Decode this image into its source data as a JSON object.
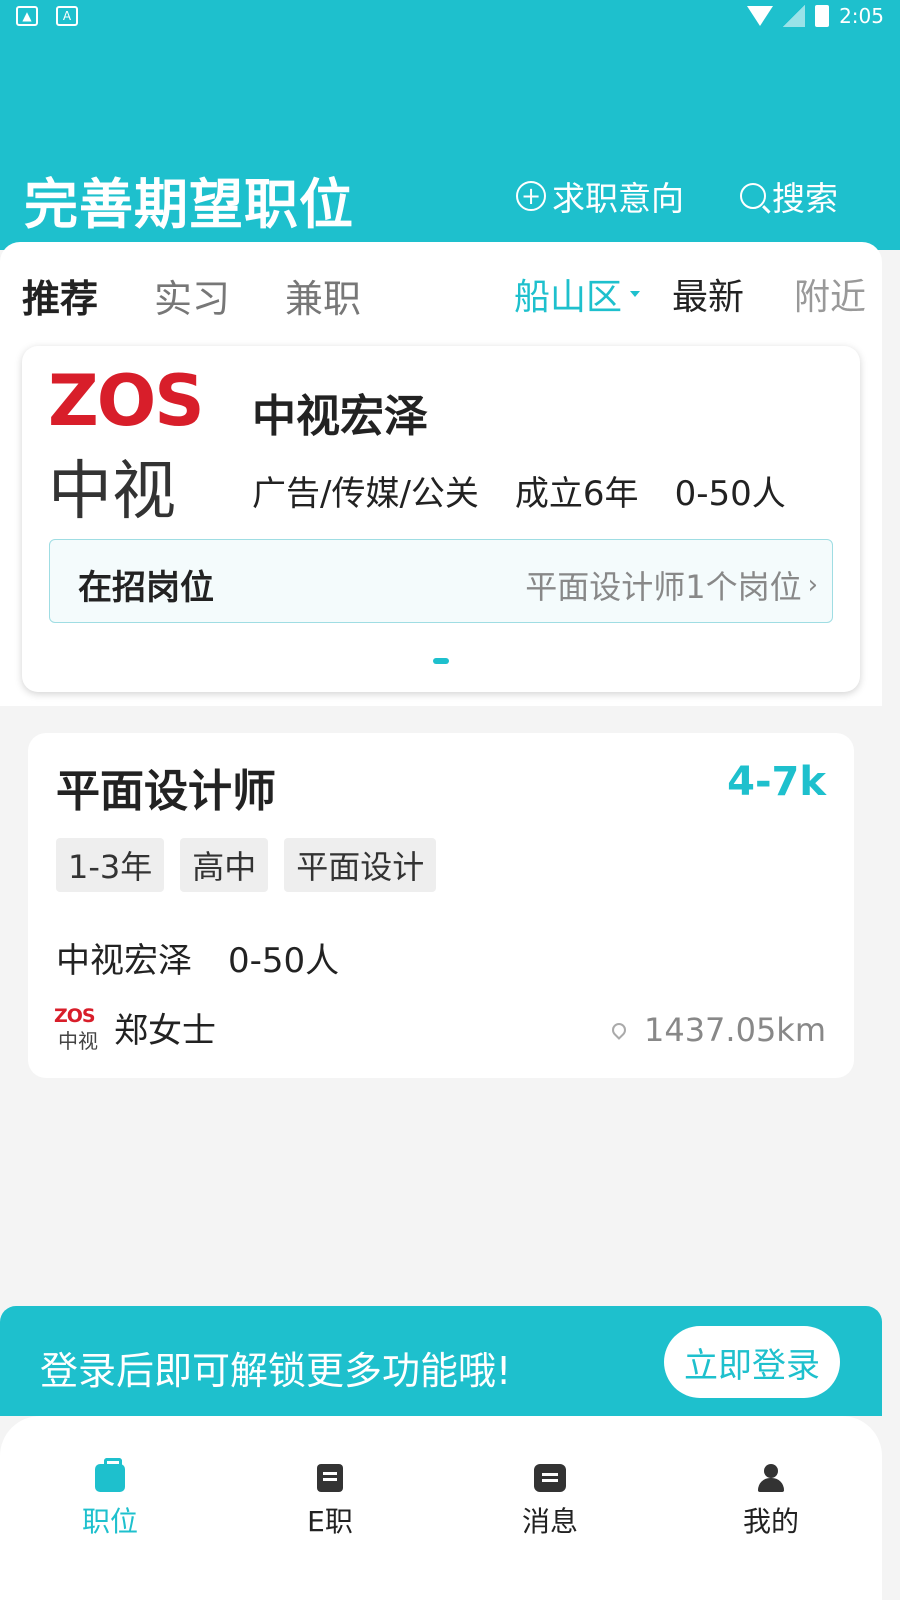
{
  "status_bar": {
    "time": "2:05",
    "left_icons": [
      "image-icon",
      "a-icon"
    ],
    "right_icons": [
      "wifi-icon",
      "signal-icon",
      "battery-icon"
    ]
  },
  "header": {
    "title": "完善期望职位",
    "intent_label": "求职意向",
    "search_label": "搜索",
    "background_color": "#1ec0cd"
  },
  "tabs": [
    {
      "label": "推荐",
      "active": true
    },
    {
      "label": "实习",
      "active": false
    },
    {
      "label": "兼职",
      "active": false
    }
  ],
  "filters": {
    "area": "船山区",
    "latest": "最新",
    "nearby": "附近"
  },
  "company_card": {
    "logo_text": "ZOS",
    "logo_subtext": "中视",
    "name": "中视宏泽",
    "industry": "广告/传媒/公关",
    "founded": "成立6年",
    "size": "0-50人",
    "hiring_label": "在招岗位",
    "hiring_summary": "平面设计师1个岗位"
  },
  "job_card": {
    "title": "平面设计师",
    "salary": "4-7k",
    "tags": [
      "1-3年",
      "高中",
      "平面设计"
    ],
    "company": "中视宏泽",
    "company_size": "0-50人",
    "recruiter": "郑女士",
    "distance": "1437.05km"
  },
  "login_banner": {
    "text": "登录后即可解锁更多功能哦!",
    "button": "立即登录"
  },
  "bottom_nav": [
    {
      "label": "职位",
      "icon": "briefcase-icon",
      "active": true
    },
    {
      "label": "E职",
      "icon": "document-icon",
      "active": false
    },
    {
      "label": "消息",
      "icon": "message-icon",
      "active": false
    },
    {
      "label": "我的",
      "icon": "user-icon",
      "active": false
    }
  ],
  "accent_color": "#1ec0cd"
}
